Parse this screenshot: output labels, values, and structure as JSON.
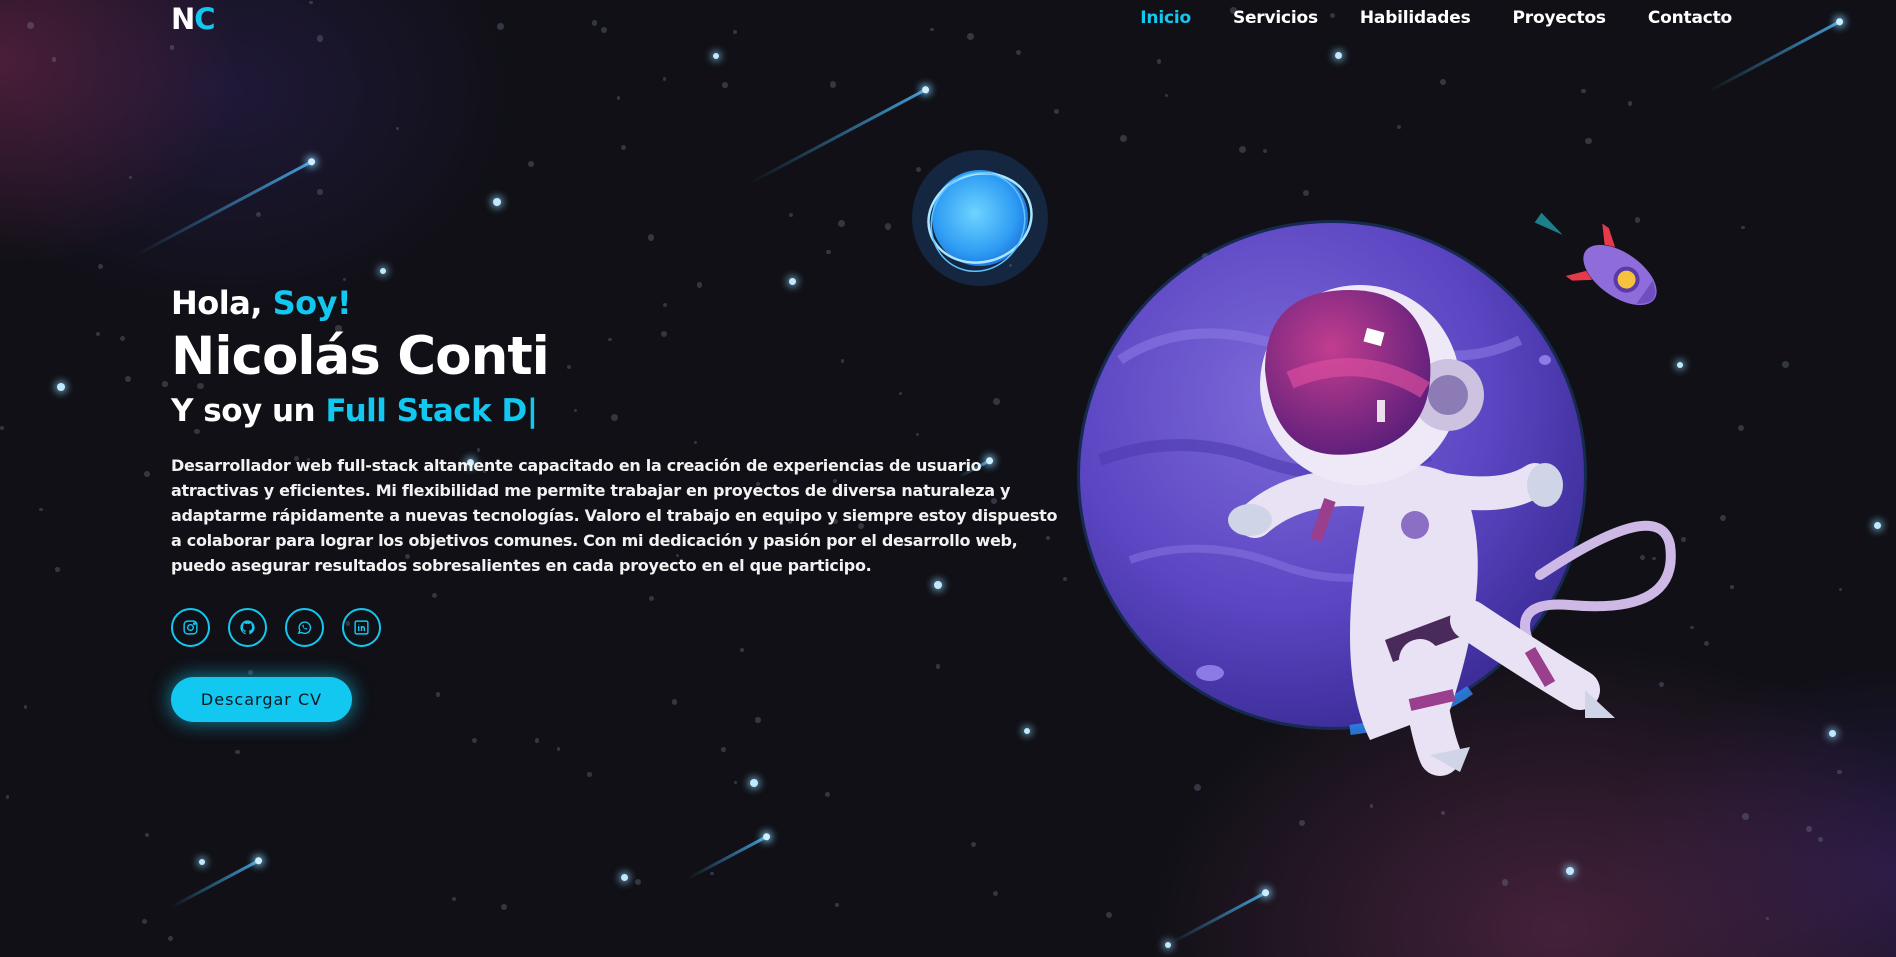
{
  "logo": {
    "first": "N",
    "second": "C"
  },
  "nav": {
    "items": [
      {
        "label": "Inicio",
        "active": true
      },
      {
        "label": "Servicios",
        "active": false
      },
      {
        "label": "Habilidades",
        "active": false
      },
      {
        "label": "Proyectos",
        "active": false
      },
      {
        "label": "Contacto",
        "active": false
      }
    ]
  },
  "hero": {
    "greeting": "Hola,",
    "greeting_accent": "Soy!",
    "name": "Nicolás Conti",
    "role_prefix": "Y soy un",
    "role_accent": "Full Stack D|",
    "description": "Desarrollador web full-stack altamente capacitado en la creación de experiencias de usuario atractivas y eficientes. Mi flexibilidad me permite trabajar en proyectos de diversa naturaleza y adaptarme rápidamente a nuevas tecnologías. Valoro el trabajo en equipo y siempre estoy dispuesto a colaborar para lograr los objetivos comunes. Con mi dedicación y pasión por el desarrollo web, puedo asegurar resultados sobresalientes en cada proyecto en el que participo.",
    "socials": [
      "instagram-icon",
      "github-icon",
      "whatsapp-icon",
      "linkedin-icon"
    ],
    "cv_button": "Descargar CV"
  },
  "colors": {
    "accent": "#12c8f0",
    "background": "#101016"
  }
}
